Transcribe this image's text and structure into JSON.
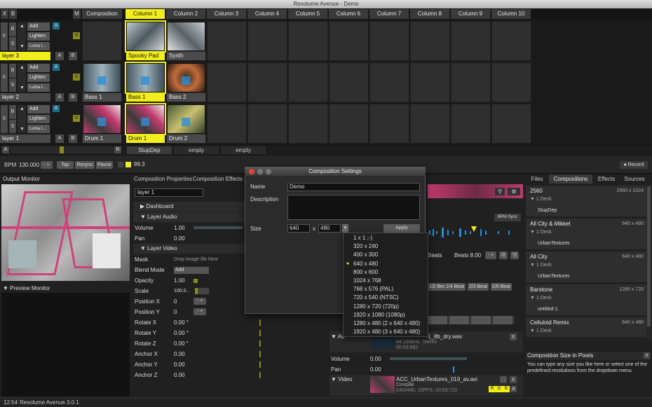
{
  "window": {
    "title": "Resolume Avenue - Demo"
  },
  "header": {
    "x": "X",
    "b": "B",
    "m": "M",
    "composition": "Composition",
    "columns": [
      "Column 1",
      "Column 2",
      "Column 3",
      "Column 4",
      "Column 5",
      "Column 6",
      "Column 7",
      "Column 8",
      "Column 9",
      "Column 10"
    ]
  },
  "layers": [
    {
      "name": "layer 3",
      "blend1": "Add",
      "blend2": "Lighten",
      "blend3": "Luma I...",
      "clips": [
        "Spooky Pad",
        "Synth"
      ]
    },
    {
      "name": "layer 2",
      "blend1": "Add",
      "blend2": "Lighten",
      "blend3": "Luma I...",
      "clips": [
        "Bass 1",
        "Bass 1",
        "Bass 2"
      ]
    },
    {
      "name": "layer 1",
      "blend1": "Add",
      "blend2": "Lighten",
      "blend3": "Luma I...",
      "clips": [
        "Drum 1",
        "Drum 1",
        "Drum 2"
      ]
    }
  ],
  "layer_buttons": {
    "x": "X",
    "s": "S",
    "a": "A",
    "b": "B",
    "v": "V"
  },
  "deck": {
    "a": "A",
    "b": "B",
    "decks": [
      "StupDep",
      "empty",
      "empty"
    ]
  },
  "transport": {
    "bpm_label": "BPM",
    "bpm": "130.000",
    "minus_plus": "- +",
    "tap": "Tap",
    "resync": "Resync",
    "pause": "Pause",
    "value": "99.3",
    "record": "Record"
  },
  "output_monitor": {
    "title": "Output Monitor"
  },
  "preview_monitor": {
    "title": "Preview Monitor"
  },
  "props": {
    "tabs": [
      "Composition Properties",
      "Composition Effects"
    ],
    "layer_name": "layer 1",
    "dashboard": "Dashboard",
    "layer_audio": "Layer Audio",
    "volume_label": "Volume",
    "volume": "1.00",
    "pan_label": "Pan",
    "pan": "0.00",
    "layer_video": "Layer Video",
    "mask_label": "Mask",
    "mask_hint": "Drop image file here",
    "blend_label": "Blend Mode",
    "blend": "Add",
    "opacity_label": "Opacity",
    "opacity": "1.00",
    "scale_label": "Scale",
    "scale": "100.0...",
    "posx_label": "Position X",
    "posx": "0",
    "posy_label": "Position Y",
    "posy": "0",
    "rotx_label": "Rotate X",
    "rotx": "0.00 °",
    "roty_label": "Rotate Y",
    "roty": "0.00 °",
    "rotz_label": "Rotate Z",
    "rotz": "0.00 °",
    "ancx_label": "Anchor X",
    "ancx": "0.00",
    "ancy_label": "Anchor Y",
    "ancy": "0.00",
    "ancz_label": "Anchor Z",
    "ancz": "0.00"
  },
  "clip": {
    "bpm_sync": "BPM Sync",
    "beats_label": "Beats",
    "beats": "Beats 8.00",
    "half": "/2",
    "x2": "*2",
    "beat_buttons": [
      "1/2 Beat",
      "1/4 Beat",
      "2/3 Beat",
      "2/6 Beat"
    ],
    "audio_label": "Au",
    "audio_file": "1_8b_dry.wav",
    "audio_info1": "44.100kHz, Stereo",
    "audio_info2": "00:03:692",
    "volume_label": "Volume",
    "volume": "0.00",
    "pan_label": "Pan",
    "pan": "0.00",
    "video_label": "Video",
    "video_file": "ACC_UrbanTextures_019_av.avi",
    "video_codec": "Cinepak",
    "video_info": "640x480, 25FPS, 00:03:720",
    "rgb": [
      "R",
      "G",
      "B"
    ],
    "a": "A"
  },
  "right_tabs": [
    "Files",
    "Compositions",
    "Effects",
    "Sources"
  ],
  "compositions": [
    {
      "name": "2560",
      "size": "2560 x 1024",
      "deck": "1 Deck",
      "item": "StupDep"
    },
    {
      "name": "All City & Mikkel",
      "size": "640 x 480",
      "deck": "1 Deck",
      "item": "UrbanTextures"
    },
    {
      "name": "All City",
      "size": "640 x 480",
      "deck": "1 Deck",
      "item": "UrbanTextures"
    },
    {
      "name": "Barstone",
      "size": "1280 x 720",
      "deck": "1 Deck",
      "item": "untitled-1"
    },
    {
      "name": "Celluloid Remix",
      "size": "640 x 480",
      "deck": "1 Deck",
      "item": ""
    }
  ],
  "help": {
    "title": "Composition Size in Pixels",
    "text": "You can type any size you like here or select one of the predefined resolutions from the dropdown menu."
  },
  "dialog": {
    "title": "Composition Settings",
    "name_label": "Name",
    "name": "Demo",
    "desc_label": "Description",
    "size_label": "Size",
    "width": "640",
    "x": "x",
    "height": "480",
    "apply": "Apply",
    "options": [
      "1 x 1 ;-)",
      "320 x 240",
      "400 x 300",
      "640 x 480",
      "800 x 600",
      "1024 x 768",
      "768 x 576 (PAL)",
      "720 x 540 (NTSC)",
      "1280 x 720 (720p)",
      "1920 x 1080 (1080p)",
      "1280 x 480 (2 x 640 x 480)",
      "1920 x 480 (3 x 640 x 480)"
    ],
    "selected_index": 3
  },
  "status": {
    "time": "12:54",
    "app": "Resolume Avenue 3.0.1"
  },
  "colors": {
    "accent": "#f2ee1e",
    "pink": "#d0417a",
    "blue": "#2a8fd6"
  }
}
